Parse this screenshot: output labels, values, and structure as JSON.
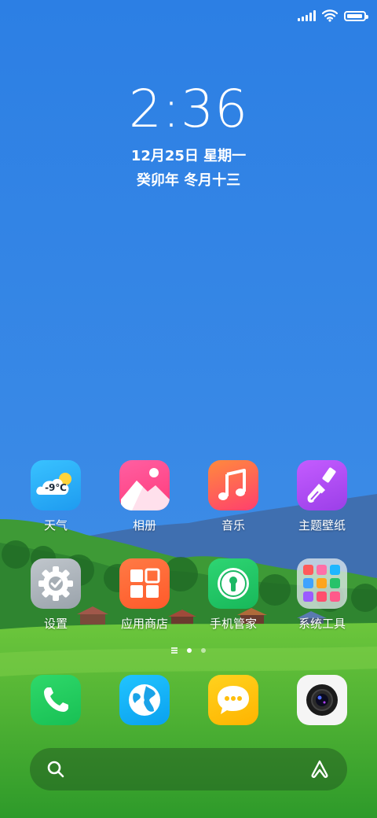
{
  "status_bar": {
    "battery_level": 0.95
  },
  "clock": {
    "time": "2:36",
    "date": "12月25日 星期一",
    "lunar": "癸卯年 冬月十三"
  },
  "apps": [
    {
      "label": "天气",
      "icon": "weather-icon",
      "temp": "-9℃"
    },
    {
      "label": "相册",
      "icon": "gallery-icon"
    },
    {
      "label": "音乐",
      "icon": "music-icon"
    },
    {
      "label": "主题壁纸",
      "icon": "themes-icon"
    },
    {
      "label": "设置",
      "icon": "settings-icon"
    },
    {
      "label": "应用商店",
      "icon": "app-store-icon"
    },
    {
      "label": "手机管家",
      "icon": "security-icon"
    },
    {
      "label": "系统工具",
      "icon": "folder-icon"
    }
  ],
  "dock": [
    {
      "icon": "phone-icon"
    },
    {
      "icon": "browser-icon"
    },
    {
      "icon": "messages-icon"
    },
    {
      "icon": "camera-icon"
    }
  ],
  "pages": {
    "count": 2,
    "current": 1
  },
  "colors": {
    "sky": "#2f83e4",
    "grass": "#3fb02e",
    "mountain": "#3f6fb0"
  }
}
